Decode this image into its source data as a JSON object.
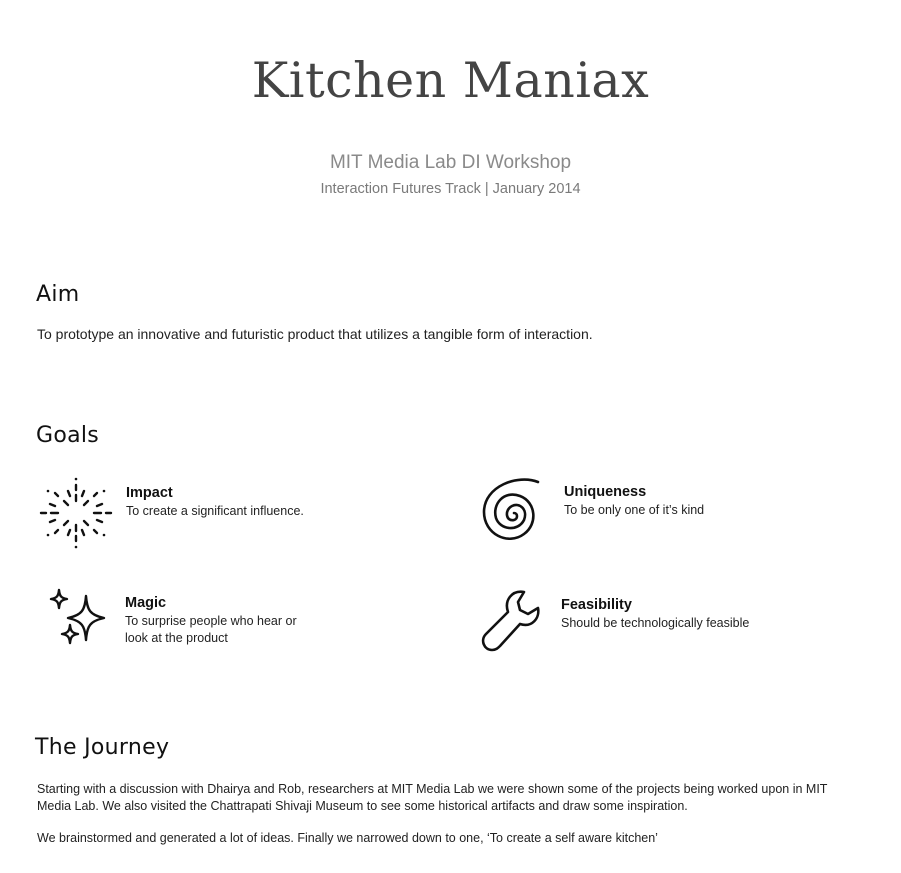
{
  "header": {
    "title": "Kitchen Maniax",
    "subtitle": "MIT Media Lab DI Workshop",
    "subline": "Interaction Futures Track | January 2014"
  },
  "aim": {
    "heading": "Aim",
    "text": "To prototype an innovative and futuristic product that utilizes a tangible form of interaction."
  },
  "goals": {
    "heading": "Goals",
    "items": [
      {
        "title": "Impact",
        "desc": "To create a significant influence.",
        "icon": "burst-icon"
      },
      {
        "title": "Uniqueness",
        "desc": "To be only one of it’s kind",
        "icon": "spiral-icon"
      },
      {
        "title": "Magic",
        "desc": "To surprise people who hear or look at the product",
        "icon": "sparkles-icon"
      },
      {
        "title": "Feasibility",
        "desc": "Should be technologically feasible",
        "icon": "wrench-icon"
      }
    ]
  },
  "journey": {
    "heading": "The Journey",
    "paragraph1": "Starting with a discussion with Dhairya and Rob, researchers at MIT Media Lab we were shown some of the projects being worked upon in MIT Media Lab. We also visited the Chattrapati Shivaji Museum to see some historical artifacts and draw some inspiration.",
    "paragraph2": "We brainstormed and generated a lot of ideas. Finally we narrowed down to one, ‘To create a self aware kitchen’"
  }
}
